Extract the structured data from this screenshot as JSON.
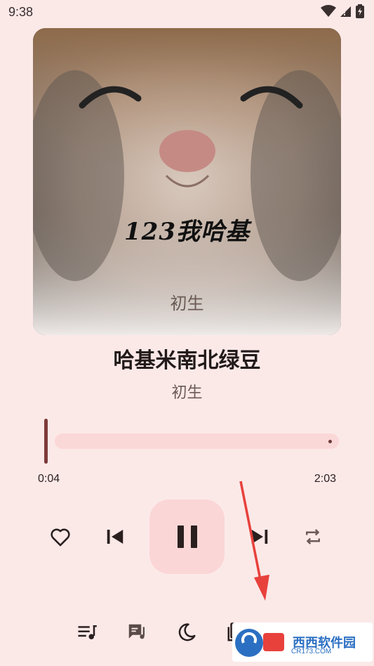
{
  "status_bar": {
    "time": "9:38",
    "icons": [
      "wifi-icon",
      "signal-icon",
      "battery-charging-icon"
    ]
  },
  "album": {
    "overlay_title": "123我哈基",
    "overlay_artist": "初生",
    "image": "cat-photo"
  },
  "song": {
    "title": "哈基米南北绿豆",
    "artist": "初生"
  },
  "progress": {
    "current": "0:04",
    "total": "2:03",
    "fraction": 0.03
  },
  "controls": {
    "like_icon": "heart-icon",
    "prev_icon": "skip-previous-icon",
    "play_icon": "pause-icon",
    "next_icon": "skip-next-icon",
    "repeat_icon": "repeat-icon"
  },
  "bottom_bar": {
    "icons": [
      "playlist-icon",
      "lyrics-icon",
      "sleep-timer-icon",
      "add-to-playlist-icon",
      "more-icon"
    ]
  },
  "watermark": {
    "brand": "西西软件园",
    "url": "CR173.COM"
  },
  "colors": {
    "background": "#fbe9e8",
    "accent": "#7c3b39",
    "play_button_bg": "#fbd6d6",
    "progress_track": "#fbd8d8",
    "annotation_arrow": "#e8413c"
  }
}
